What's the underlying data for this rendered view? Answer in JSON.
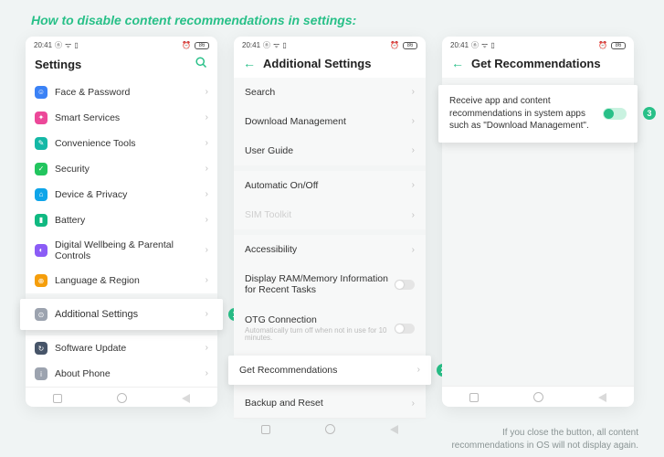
{
  "banner": "How to disable content recommendations in settings:",
  "status": {
    "time": "20:41",
    "battery": "86"
  },
  "phone1": {
    "title": "Settings",
    "items": [
      {
        "icon": "i-blue",
        "glyph": "☺",
        "label": "Face & Password"
      },
      {
        "icon": "i-pink",
        "glyph": "✦",
        "label": "Smart Services"
      },
      {
        "icon": "i-teal",
        "glyph": "✎",
        "label": "Convenience Tools"
      },
      {
        "icon": "i-green",
        "glyph": "✓",
        "label": "Security"
      },
      {
        "icon": "i-sky",
        "glyph": "⌂",
        "label": "Device & Privacy"
      },
      {
        "icon": "i-emerald",
        "glyph": "▮",
        "label": "Battery"
      },
      {
        "icon": "i-violet",
        "glyph": "◐",
        "label": "Digital Wellbeing & Parental Controls"
      },
      {
        "icon": "i-amber",
        "glyph": "⊕",
        "label": "Language & Region"
      }
    ],
    "highlight": {
      "icon": "i-gray",
      "glyph": "⊙",
      "label": "Additional Settings",
      "badge": "1"
    },
    "tail": [
      {
        "icon": "i-dark",
        "glyph": "↻",
        "label": "Software Update"
      },
      {
        "icon": "i-gray",
        "glyph": "i",
        "label": "About Phone"
      }
    ]
  },
  "phone2": {
    "title": "Additional Settings",
    "group1": [
      {
        "label": "Search"
      },
      {
        "label": "Download Management"
      },
      {
        "label": "User Guide"
      }
    ],
    "group2": [
      {
        "label": "Automatic On/Off"
      },
      {
        "label": "SIM Toolkit",
        "dim": true
      }
    ],
    "group3": [
      {
        "label": "Accessibility"
      },
      {
        "label": "Display RAM/Memory Information for Recent Tasks",
        "toggle": true
      },
      {
        "label": "OTG Connection",
        "sub": "Automatically turn off when not in use for 10 minutes.",
        "toggle": true
      }
    ],
    "highlight": {
      "label": "Get Recommendations",
      "badge": "2"
    },
    "tail": [
      {
        "label": "Backup and Reset"
      }
    ]
  },
  "phone3": {
    "title": "Get Recommendations",
    "card_text": "Receive app and content recommendations in system apps such as \"Download Management\".",
    "badge": "3"
  },
  "footer_note_line1": "If you close the button, all content",
  "footer_note_line2": "recommendations in OS will not display again."
}
